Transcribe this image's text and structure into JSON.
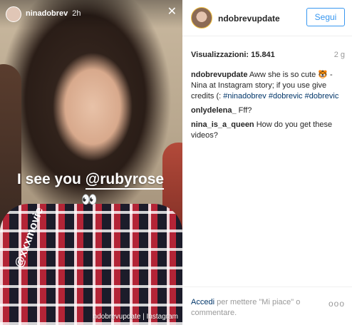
{
  "story": {
    "username": "ninadobrev",
    "time": "2h",
    "close_icon": "close-icon",
    "overlay_text_prefix": "I see you ",
    "overlay_handle": "@rubyrose",
    "eyes_emoji": "👀",
    "vertical_text": "@xxxmovie",
    "watermark": "ndobrevupdate | Instagram"
  },
  "post": {
    "username": "ndobrevupdate",
    "follow_label": "Segui",
    "views_label": "Visualizzazioni: 15.841",
    "age": "2 g",
    "comments": [
      {
        "user": "ndobrevupdate",
        "text_before": " Aww she is so cute 🐯 - Nina at Instagram story; if you use give credits (: ",
        "tags": [
          "#ninadobrev",
          "#dobrevic",
          "#dobrevic"
        ]
      },
      {
        "user": "onlydelena_",
        "text": " Fff?"
      },
      {
        "user": "nina_is_a_queen",
        "text": " How do you get these videos?"
      }
    ],
    "login_link": "Accedi",
    "login_text": " per mettere \"Mi piace\" o commentare.",
    "more_label": "ooo"
  }
}
